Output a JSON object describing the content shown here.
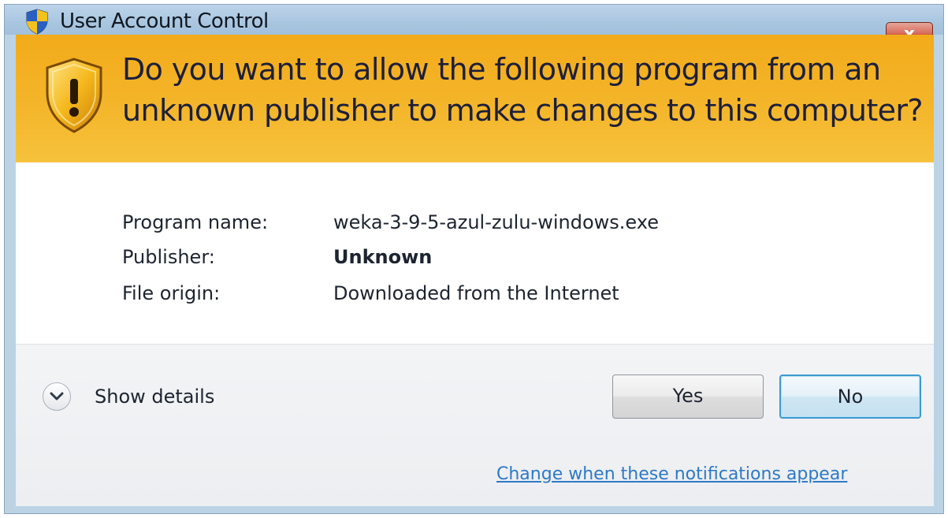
{
  "window": {
    "title": "User Account Control",
    "close_label": "x"
  },
  "banner": {
    "heading_line1": "Do you want to allow the following program from an",
    "heading_line2": "unknown publisher to make changes to this computer?"
  },
  "details": {
    "program_name_label": "Program name:",
    "program_name_value": "weka-3-9-5-azul-zulu-windows.exe",
    "publisher_label": "Publisher:",
    "publisher_value": "Unknown",
    "file_origin_label": "File origin:",
    "file_origin_value": "Downloaded from the Internet"
  },
  "footer": {
    "show_details_label": "Show details",
    "yes_label": "Yes",
    "no_label": "No",
    "notifications_link": "Change when these notifications appear"
  },
  "colors": {
    "banner": "#f4b52a",
    "titlebar": "#a9c6e0",
    "link": "#2e79c6",
    "close_button": "#c94735"
  },
  "icons": {
    "title_icon": "uac-shield-icon",
    "banner_icon": "warning-shield-icon",
    "toggle_icon": "chevron-down-icon",
    "close_icon": "close-icon"
  }
}
